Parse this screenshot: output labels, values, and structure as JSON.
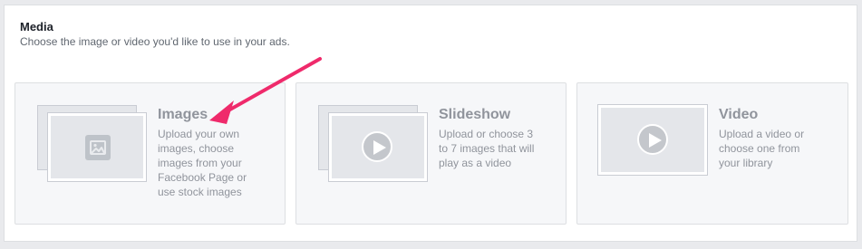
{
  "media": {
    "title": "Media",
    "subtitle": "Choose the image or video you'd like to use in your ads."
  },
  "options": [
    {
      "title": "Images",
      "description": "Upload your own images, choose images from your Facebook Page or use stock images",
      "icon": "image-icon"
    },
    {
      "title": "Slideshow",
      "description": "Upload or choose 3 to 7 images that will play as a video",
      "icon": "play-icon"
    },
    {
      "title": "Video",
      "description": "Upload a video or choose one from your library",
      "icon": "play-icon"
    }
  ],
  "colors": {
    "annotation_arrow": "#ef2a6b",
    "card_background": "#f6f7f9",
    "muted_text": "#90949c"
  }
}
